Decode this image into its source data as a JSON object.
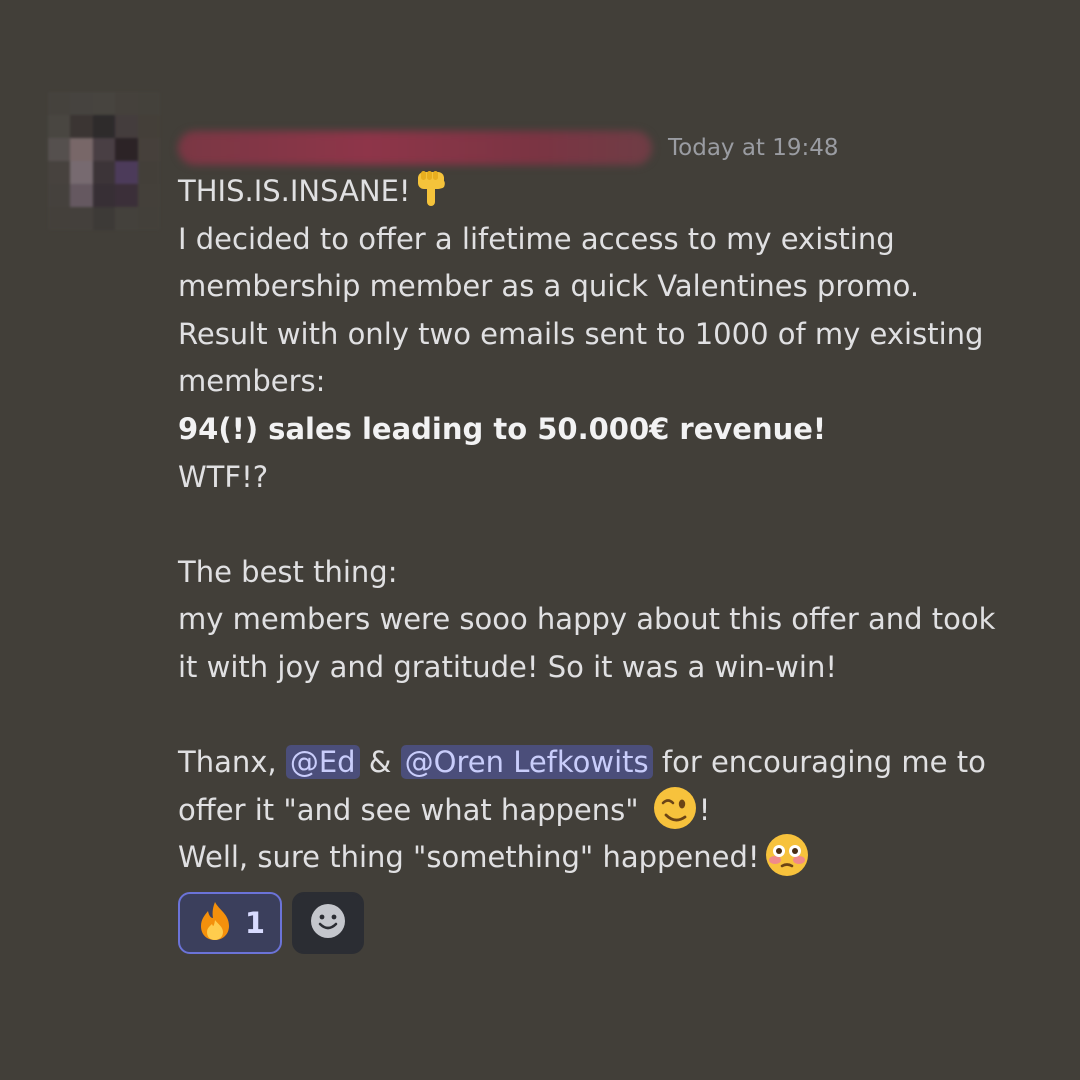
{
  "message": {
    "timestamp": "Today at 19:48",
    "lines": {
      "l1": "THIS.IS.INSANE!",
      "l2": "I decided to offer a lifetime access to my existing",
      "l3": "membership member as a quick Valentines promo.",
      "l4": "Result with only two emails sent to 1000 of my existing",
      "l5": "members:",
      "l6": "94(!) sales leading to 50.000€ revenue!",
      "l7": "WTF!?",
      "l8": "The best thing:",
      "l9": "my members were sooo happy about this offer and took",
      "l10": "it with joy and gratitude! So it was a win-win!",
      "l11_prefix": "Thanx, ",
      "l11_mention1": "@Ed",
      "l11_mid": " & ",
      "l11_mention2": "@Oren Lefkowits",
      "l11_suffix": " for encouraging me to",
      "l12_prefix": "offer it \"and see what happens\" ",
      "l12_suffix": "!",
      "l13": "Well, sure thing \"something\" happened!"
    }
  },
  "icons": {
    "pointing_down": "backhand-index-pointing-down-icon",
    "wink": "winking-face-icon",
    "flushed": "flushed-face-icon",
    "fire": "fire-icon",
    "add_reaction": "add-reaction-smiley-icon"
  },
  "reactions": {
    "fire_count": "1"
  },
  "colors": {
    "background": "#423f39",
    "mention_bg": "#4b4e7a",
    "mention_text": "#c9cdfb",
    "reaction_border": "#6b73d8"
  }
}
